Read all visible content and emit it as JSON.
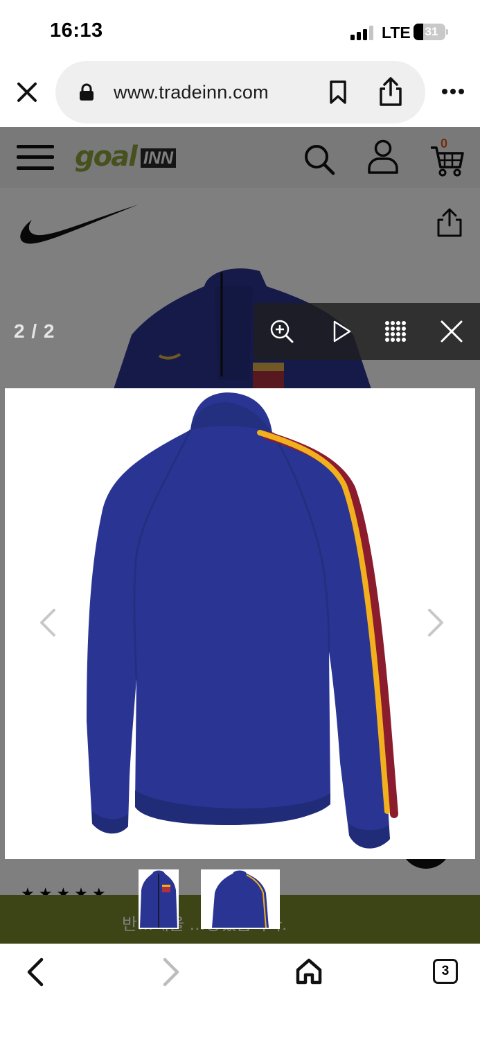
{
  "status_bar": {
    "time": "16:13",
    "network": "LTE",
    "battery": "31",
    "battery_level": 0.31
  },
  "browser": {
    "url": "www.tradeinn.com",
    "icons": [
      "close-icon",
      "lock-icon",
      "bookmark-icon",
      "share-icon",
      "more-icon"
    ]
  },
  "site": {
    "logo_primary": "goal",
    "logo_secondary": "INN",
    "cart_count": "0",
    "brand": "nike-logo",
    "banner_text": "반…해을 …장했습니다.",
    "accent_color": "#8ea33b"
  },
  "lightbox": {
    "counter": "2 / 2",
    "tools": [
      "zoom-in-icon",
      "play-icon",
      "grid-icon",
      "close-icon"
    ],
    "image_alt": "Navy track jacket, back view, with red and yellow stripe down the sleeve",
    "thumbnails": [
      "front-view",
      "back-view"
    ],
    "jacket_color": "#2a3593",
    "stripe_colors": [
      "#f2b01e",
      "#8a1c2e"
    ]
  },
  "bottom_nav": {
    "tab_count": "3"
  }
}
